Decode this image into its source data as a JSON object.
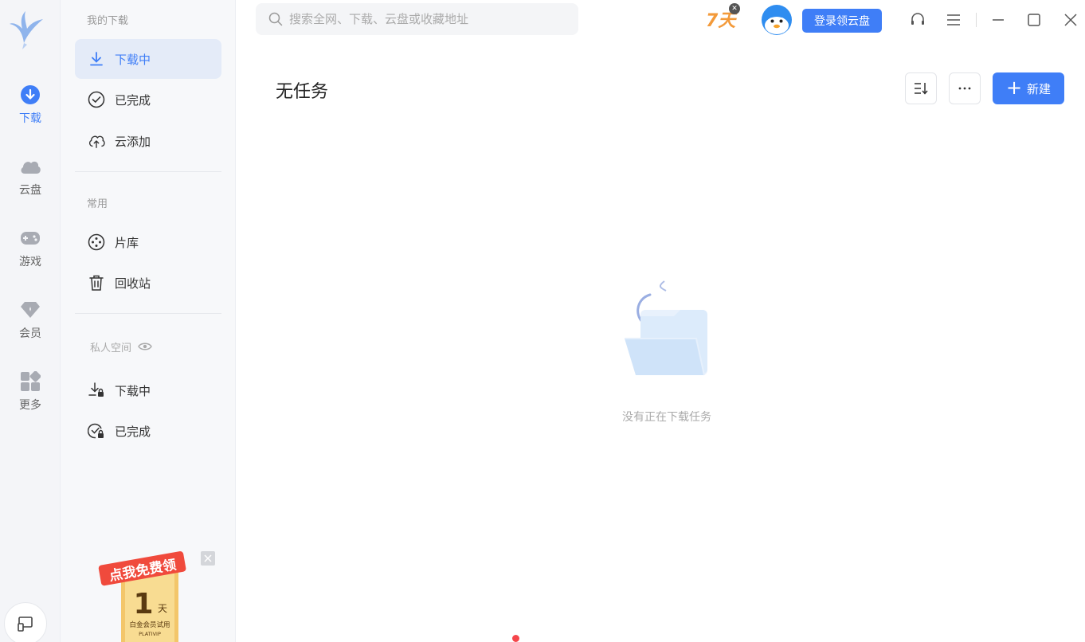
{
  "rail": {
    "items": [
      {
        "label": "下载",
        "icon": "download-circle-icon",
        "active": true
      },
      {
        "label": "云盘",
        "icon": "cloud-icon"
      },
      {
        "label": "游戏",
        "icon": "gamepad-icon"
      },
      {
        "label": "会员",
        "icon": "diamond-icon"
      },
      {
        "label": "更多",
        "icon": "apps-grid-icon"
      }
    ]
  },
  "sidebar": {
    "my_downloads_title": "我的下载",
    "downloading": "下载中",
    "completed": "已完成",
    "cloud_add": "云添加",
    "common_title": "常用",
    "film_library": "片库",
    "recycle_bin": "回收站",
    "private_space_title": "私人空间",
    "private_downloading": "下载中",
    "private_completed": "已完成",
    "promo": {
      "ribbon": "点我免费领",
      "days": "1",
      "unit": "天",
      "caption": "白金会员试用",
      "code": "PLATIVIP"
    }
  },
  "header": {
    "search_placeholder": "搜索全网、下载、云盘或收藏地址",
    "badge_text": "7天",
    "login_button": "登录领云盘"
  },
  "main": {
    "title": "无任务",
    "new_button": "新建",
    "empty_text": "没有正在下载任务"
  },
  "colors": {
    "accent": "#3f7ef7",
    "promo_red": "#f04a3c",
    "promo_gold": "#f3c66a"
  }
}
